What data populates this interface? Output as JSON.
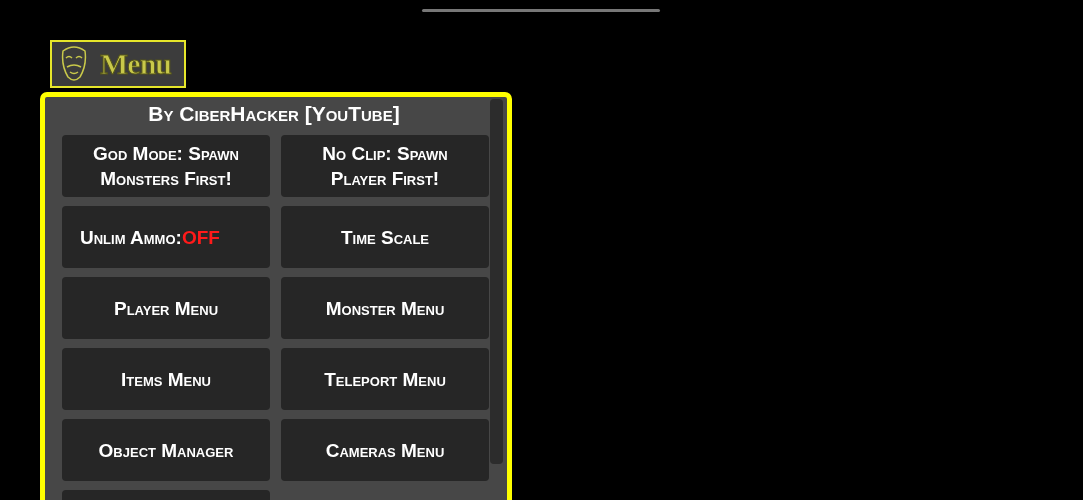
{
  "menu_toggle": {
    "label": "Menu"
  },
  "panel": {
    "title": "By CiberHacker [YouTube]",
    "buttons": [
      {
        "kind": "action",
        "label": "God Mode: Spawn Monsters First!"
      },
      {
        "kind": "action",
        "label": "No Clip: Spawn Player First!"
      },
      {
        "kind": "toggle",
        "label": "Unlim Ammo:",
        "status": "OFF",
        "on": false
      },
      {
        "kind": "action",
        "label": "Time Scale"
      },
      {
        "kind": "action",
        "label": "Player Menu"
      },
      {
        "kind": "action",
        "label": "Monster Menu"
      },
      {
        "kind": "action",
        "label": "Items Menu"
      },
      {
        "kind": "action",
        "label": "Teleport Menu"
      },
      {
        "kind": "action",
        "label": "Object Manager"
      },
      {
        "kind": "action",
        "label": "Cameras Menu"
      },
      {
        "kind": "cut"
      }
    ]
  }
}
